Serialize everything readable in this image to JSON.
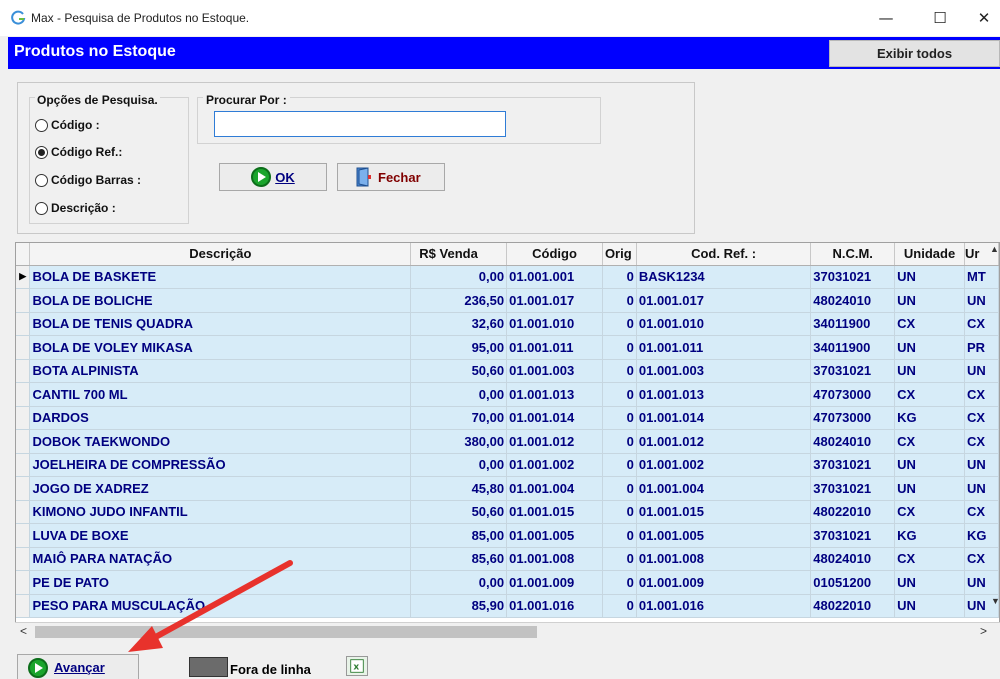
{
  "window": {
    "title": "Max - Pesquisa de Produtos no Estoque.",
    "min": "—",
    "max": "☐",
    "close": "✕"
  },
  "header": {
    "title": "Produtos no Estoque",
    "show_all": "Exibir todos"
  },
  "search": {
    "options_title": "Opções de Pesquisa.",
    "options": [
      {
        "label": "Código :",
        "selected": false
      },
      {
        "label": "Código Ref.:",
        "selected": true
      },
      {
        "label": "Código Barras :",
        "selected": false
      },
      {
        "label": "Descrição :",
        "selected": false
      }
    ],
    "search_for_label": "Procurar Por :",
    "value": "",
    "ok_label": "OK",
    "close_label": "Fechar"
  },
  "table": {
    "columns": [
      "Descrição",
      "R$ Venda",
      "Código",
      "Orig",
      "Cod. Ref. :",
      "N.C.M.",
      "Unidade",
      "Ur"
    ],
    "rows": [
      [
        "BOLA DE BASKETE",
        "0,00",
        "01.001.001",
        "0",
        "BASK1234",
        "37031021",
        "UN",
        "MT"
      ],
      [
        "BOLA DE BOLICHE",
        "236,50",
        "01.001.017",
        "0",
        "01.001.017",
        "48024010",
        "UN",
        "UN"
      ],
      [
        "BOLA DE TENIS QUADRA",
        "32,60",
        "01.001.010",
        "0",
        "01.001.010",
        "34011900",
        "CX",
        "CX"
      ],
      [
        "BOLA DE VOLEY MIKASA",
        "95,00",
        "01.001.011",
        "0",
        "01.001.011",
        "34011900",
        "UN",
        "PR"
      ],
      [
        "BOTA ALPINISTA",
        "50,60",
        "01.001.003",
        "0",
        "01.001.003",
        "37031021",
        "UN",
        "UN"
      ],
      [
        "CANTIL 700 ML",
        "0,00",
        "01.001.013",
        "0",
        "01.001.013",
        "47073000",
        "CX",
        "CX"
      ],
      [
        "DARDOS",
        "70,00",
        "01.001.014",
        "0",
        "01.001.014",
        "47073000",
        "KG",
        "CX"
      ],
      [
        "DOBOK TAEKWONDO",
        "380,00",
        "01.001.012",
        "0",
        "01.001.012",
        "48024010",
        "CX",
        "CX"
      ],
      [
        "JOELHEIRA DE COMPRESSÃO",
        "0,00",
        "01.001.002",
        "0",
        "01.001.002",
        "37031021",
        "UN",
        "UN"
      ],
      [
        "JOGO DE XADREZ",
        "45,80",
        "01.001.004",
        "0",
        "01.001.004",
        "37031021",
        "UN",
        "UN"
      ],
      [
        "KIMONO JUDO INFANTIL",
        "50,60",
        "01.001.015",
        "0",
        "01.001.015",
        "48022010",
        "CX",
        "CX"
      ],
      [
        "LUVA DE BOXE",
        "85,00",
        "01.001.005",
        "0",
        "01.001.005",
        "37031021",
        "KG",
        "KG"
      ],
      [
        "MAIÔ PARA NATAÇÃO",
        "85,60",
        "01.001.008",
        "0",
        "01.001.008",
        "48024010",
        "CX",
        "CX"
      ],
      [
        "PE DE PATO",
        "0,00",
        "01.001.009",
        "0",
        "01.001.009",
        "01051200",
        "UN",
        "UN"
      ],
      [
        "PESO PARA MUSCULAÇÃO",
        "85,90",
        "01.001.016",
        "0",
        "01.001.016",
        "48022010",
        "UN",
        "UN"
      ]
    ],
    "current_row_marker": "▶"
  },
  "footer": {
    "next_label": "Avançar",
    "legend_label": "Fora de linha",
    "excel_icon": "excel-export-icon"
  },
  "colors": {
    "header_bg": "#0000ff",
    "row_bg": "#d7ecf8",
    "row_text": "#000080",
    "arrow": "#e8322c"
  }
}
